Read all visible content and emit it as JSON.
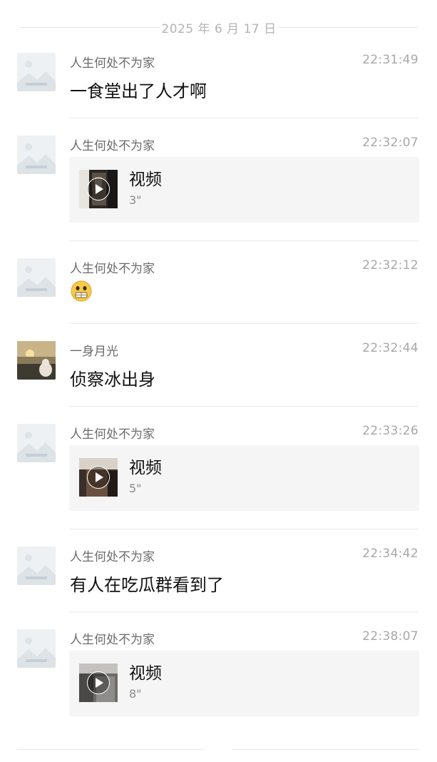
{
  "date_divider": "2025 年 6 月 17 日",
  "messages": [
    {
      "sender": "人生何处不为家",
      "time": "22:31:49",
      "type": "text",
      "text": "一食堂出了人才啊"
    },
    {
      "sender": "人生何处不为家",
      "time": "22:32:07",
      "type": "video",
      "video_label": "视频",
      "duration": "3\""
    },
    {
      "sender": "人生何处不为家",
      "time": "22:32:12",
      "type": "emoji",
      "emoji_icon": "grimace-emoji-icon"
    },
    {
      "sender": "一身月光",
      "time": "22:32:44",
      "type": "text",
      "text": "侦察冰出身"
    },
    {
      "sender": "人生何处不为家",
      "time": "22:33:26",
      "type": "video",
      "video_label": "视频",
      "duration": "5\""
    },
    {
      "sender": "人生何处不为家",
      "time": "22:34:42",
      "type": "text",
      "text": "有人在吃瓜群看到了"
    },
    {
      "sender": "人生何处不为家",
      "time": "22:38:07",
      "type": "video",
      "video_label": "视频",
      "duration": "8\""
    }
  ],
  "colors": {
    "background": "#ffffff",
    "divider": "#e8e8e8",
    "video_card_bg": "#f5f5f5",
    "sender_text": "#6a6a6a",
    "time_text": "#a8a8a8"
  }
}
